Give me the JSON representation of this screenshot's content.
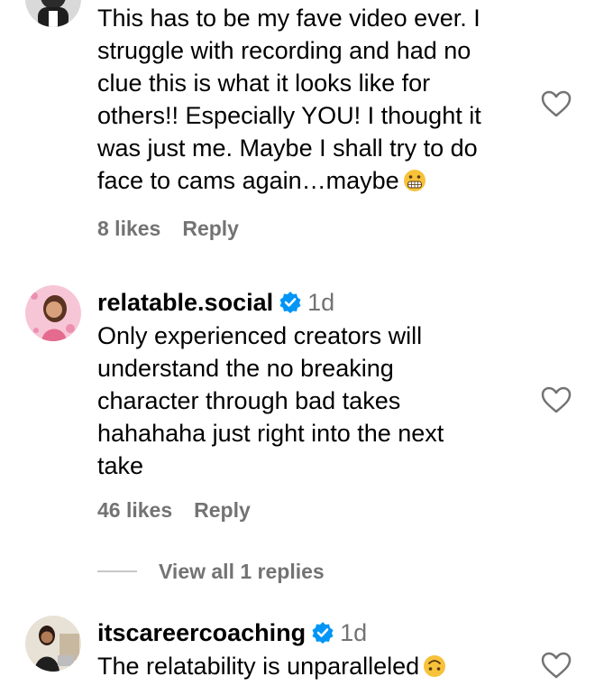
{
  "comments": [
    {
      "username": "",
      "text": "This has to be my fave video ever. I struggle with recording and had no clue this is what it looks like for others!! Especially YOU! I thought it was just me. Maybe I shall try to do face to cams again…maybe",
      "text_lines": [
        "This has to be my fave video ever. I",
        "struggle with recording and had no",
        "clue this is what it looks like for",
        "others!! Especially YOU! I thought it",
        "was just me. Maybe I shall try to do",
        "face to cams again…maybe"
      ],
      "emoji": "grimacing-face",
      "likes": "8 likes",
      "reply_label": "Reply"
    },
    {
      "username": "relatable.social",
      "verified": true,
      "time": "1d",
      "text_lines": [
        "Only experienced creators will",
        "understand the no breaking",
        "character through bad takes",
        "hahahaha just right into the next",
        "take"
      ],
      "likes": "46 likes",
      "reply_label": "Reply",
      "view_replies": "View all 1 replies"
    },
    {
      "username": "itscareercoaching",
      "verified": true,
      "time": "1d",
      "text_lines": [
        "The relatability is unparalleled"
      ],
      "emoji": "upside-down-face"
    }
  ],
  "colors": {
    "secondary_text": "#737373",
    "verified_blue": "#0095f6",
    "divider": "#c7c7c7"
  }
}
